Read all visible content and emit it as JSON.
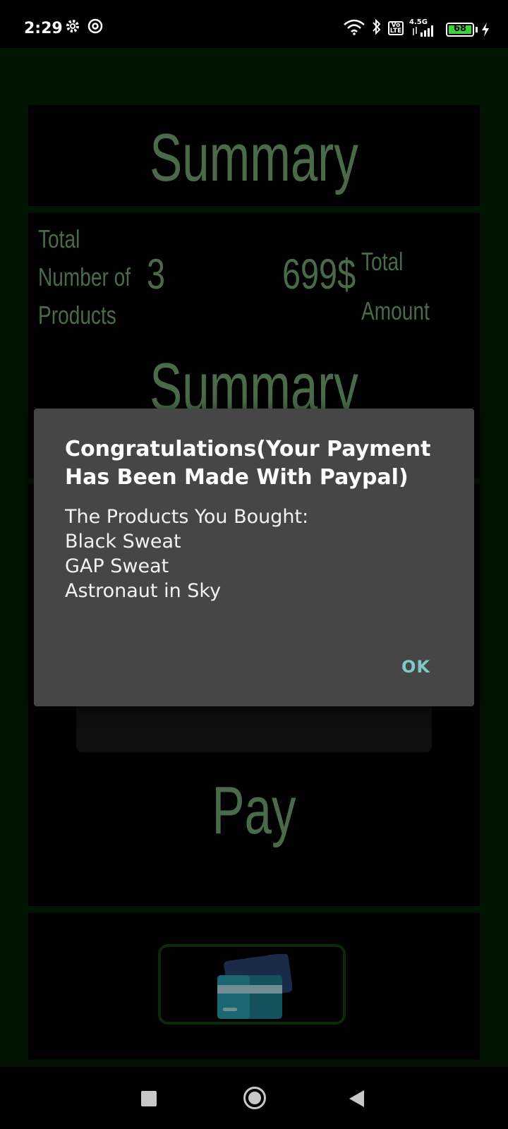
{
  "status_bar": {
    "time": "2:29",
    "battery": "68",
    "network": "4.5G",
    "volte": "Vo LTE"
  },
  "summary": {
    "title": "Summary",
    "products_label_1": "Total",
    "products_label_2": "Number of",
    "products_label_3": "Products",
    "products_count": "3",
    "amount_value": "699$",
    "amount_label_1": "Total",
    "amount_label_2": "Amount",
    "second_title": "Summary"
  },
  "pay": {
    "title": "Pay",
    "card_icon": "credit-card-icon"
  },
  "dialog": {
    "title": "Congratulations(Your Payment Has Been Made With Paypal)",
    "message_heading": "The Products You Bought:",
    "products": [
      "Black Sweat",
      "GAP Sweat",
      "Astronaut in Sky"
    ],
    "ok_label": "OK"
  },
  "colors": {
    "app_background": "#021402",
    "title_green": "#4a6a4a",
    "dialog_background": "#464646",
    "ok_accent": "#7ecbc6"
  }
}
